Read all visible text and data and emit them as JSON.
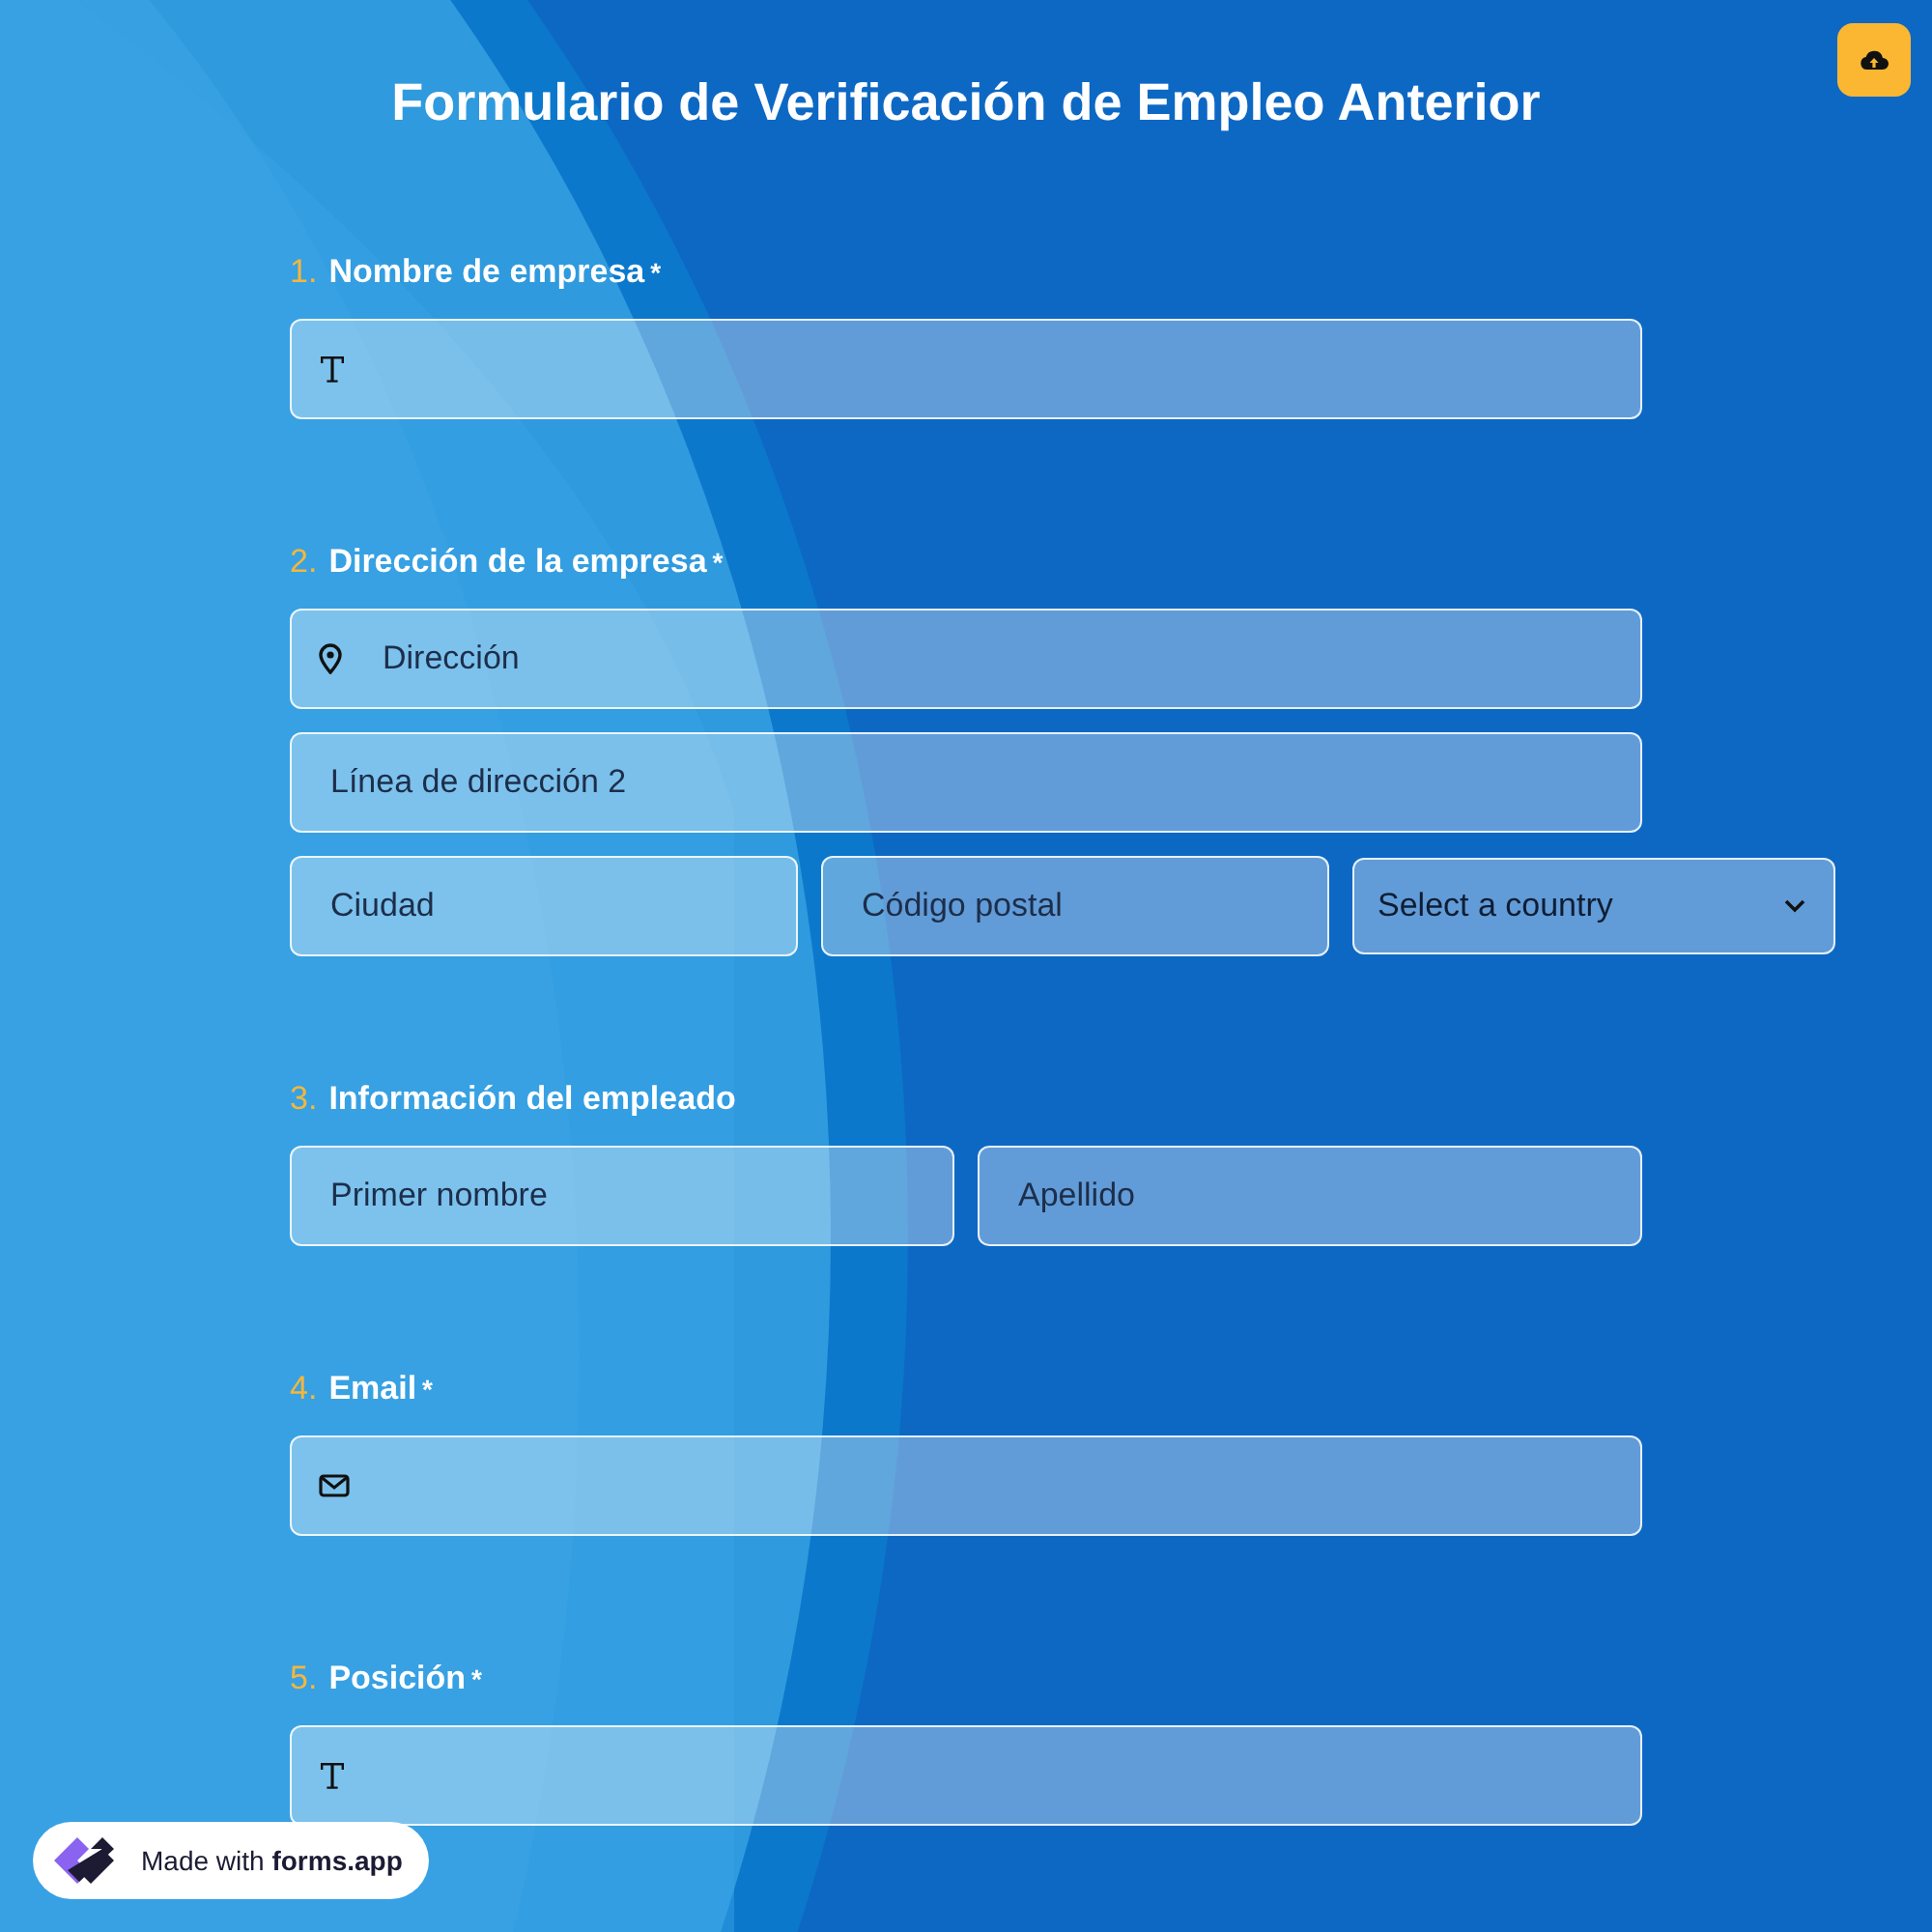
{
  "title": "Formulario de Verificación de Empleo Anterior",
  "questions": [
    {
      "number": "1.",
      "label": "Nombre de empresa",
      "required_mark": "*",
      "rows": [
        [
          {
            "kind": "text"
          }
        ]
      ]
    },
    {
      "number": "2.",
      "label": "Dirección de la empresa",
      "required_mark": "*",
      "rows": [
        [
          {
            "kind": "location",
            "placeholder": "Dirección"
          }
        ],
        [
          {
            "kind": "plain",
            "placeholder": "Línea de dirección 2"
          }
        ],
        [
          {
            "kind": "plain",
            "placeholder": "Ciudad"
          },
          {
            "kind": "plain",
            "placeholder": "Código postal"
          },
          {
            "kind": "select",
            "value": "Select a country"
          }
        ]
      ]
    },
    {
      "number": "3.",
      "label": "Información del empleado",
      "rows": [
        [
          {
            "kind": "plain",
            "placeholder": "Primer nombre"
          },
          {
            "kind": "plain",
            "placeholder": "Apellido"
          }
        ]
      ]
    },
    {
      "number": "4.",
      "label": "Email",
      "required_mark": "*",
      "rows": [
        [
          {
            "kind": "email"
          }
        ]
      ]
    },
    {
      "number": "5.",
      "label": "Posición",
      "required_mark": "*",
      "rows": [
        [
          {
            "kind": "text"
          }
        ]
      ]
    }
  ],
  "badge": {
    "prefix": "Made with",
    "brand": "forms.app"
  }
}
